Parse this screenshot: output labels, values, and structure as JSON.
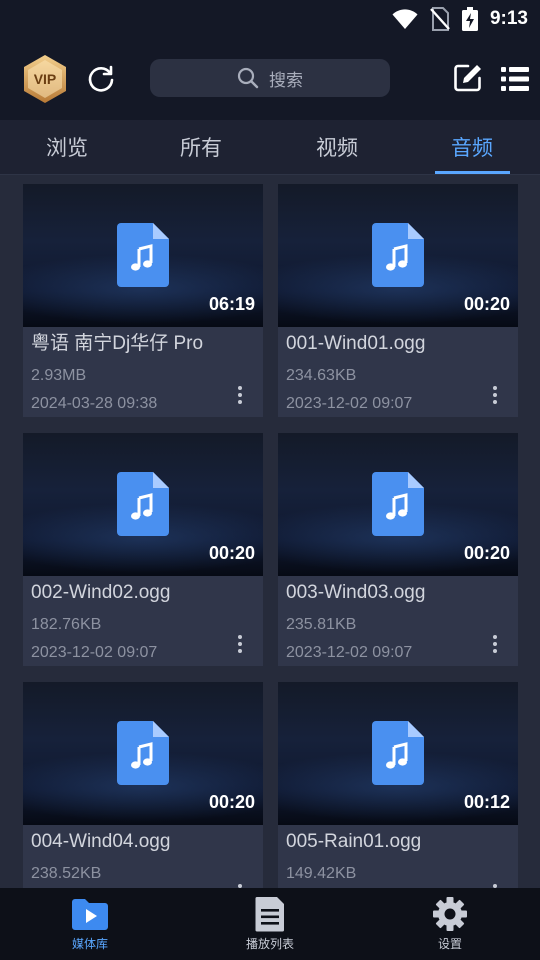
{
  "status_bar": {
    "time": "9:13",
    "icons": [
      "wifi-icon",
      "no-sim-icon",
      "battery-charging-icon"
    ]
  },
  "header": {
    "vip_label": "VIP",
    "search_placeholder": "搜索",
    "icons": [
      "vip-badge-icon",
      "refresh-icon",
      "search-icon",
      "edit-icon",
      "menu-list-icon"
    ]
  },
  "tabs": [
    {
      "label": "浏览",
      "active": false
    },
    {
      "label": "所有",
      "active": false
    },
    {
      "label": "视频",
      "active": false
    },
    {
      "label": "音频",
      "active": true
    }
  ],
  "media_items": [
    {
      "name": "粤语 南宁Dj华仔 Pro",
      "size": "2.93MB",
      "date": "2024-03-28 09:38",
      "duration": "06:19",
      "icon": "audio-file-icon"
    },
    {
      "name": "001-Wind01.ogg",
      "size": "234.63KB",
      "date": "2023-12-02 09:07",
      "duration": "00:20",
      "icon": "audio-file-icon"
    },
    {
      "name": "002-Wind02.ogg",
      "size": "182.76KB",
      "date": "2023-12-02 09:07",
      "duration": "00:20",
      "icon": "audio-file-icon"
    },
    {
      "name": "003-Wind03.ogg",
      "size": "235.81KB",
      "date": "2023-12-02 09:07",
      "duration": "00:20",
      "icon": "audio-file-icon"
    },
    {
      "name": "004-Wind04.ogg",
      "size": "238.52KB",
      "date": "",
      "duration": "00:20",
      "icon": "audio-file-icon"
    },
    {
      "name": "005-Rain01.ogg",
      "size": "149.42KB",
      "date": "",
      "duration": "00:12",
      "icon": "audio-file-icon"
    }
  ],
  "bottom_nav": [
    {
      "label": "媒体库",
      "icon": "media-library-icon",
      "active": true
    },
    {
      "label": "播放列表",
      "icon": "playlist-icon",
      "active": false
    },
    {
      "label": "设置",
      "icon": "settings-icon",
      "active": false
    }
  ],
  "colors": {
    "accent": "#5aa7ff",
    "background": "#262b3b",
    "card": "#30364a",
    "header": "#141826",
    "vip_gold": "#d8a45a",
    "file_icon": "#4a90f0"
  }
}
